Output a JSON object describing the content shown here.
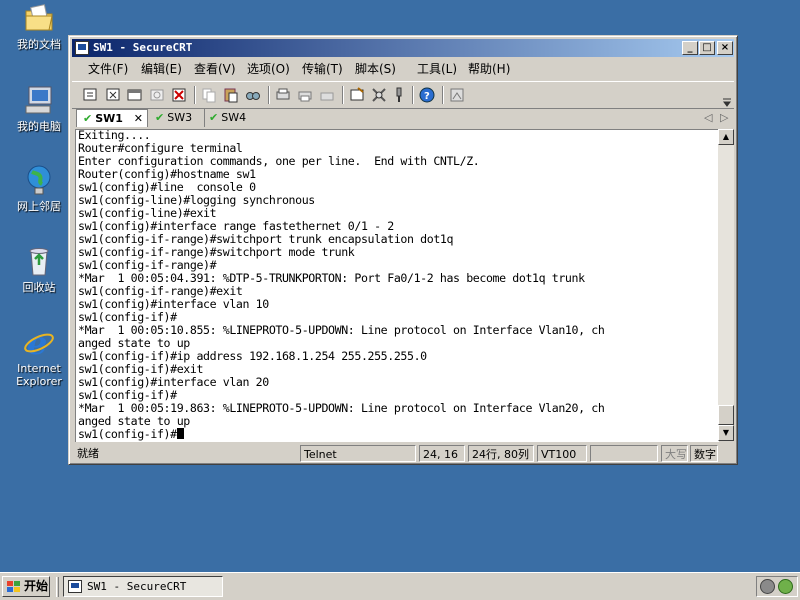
{
  "desktop": {
    "icons": [
      {
        "label": "我的文档"
      },
      {
        "label": "我的电脑"
      },
      {
        "label": "网上邻居"
      },
      {
        "label": "回收站"
      },
      {
        "label": "Internet Explorer"
      }
    ]
  },
  "window": {
    "title": "SW1 - SecureCRT",
    "menu": [
      "文件(F)",
      "编辑(E)",
      "查看(V)",
      "选项(O)",
      "传输(T)",
      "脚本(S)",
      "工具(L)",
      "帮助(H)"
    ],
    "tabs": [
      {
        "label": "SW1",
        "active": true
      },
      {
        "label": "SW3",
        "active": false
      },
      {
        "label": "SW4",
        "active": false
      }
    ],
    "terminal_lines": [
      "Exiting....",
      "Router#configure terminal",
      "Enter configuration commands, one per line.  End with CNTL/Z.",
      "Router(config)#hostname sw1",
      "sw1(config)#line  console 0",
      "sw1(config-line)#logging synchronous",
      "sw1(config-line)#exit",
      "sw1(config)#interface range fastethernet 0/1 - 2",
      "sw1(config-if-range)#switchport trunk encapsulation dot1q",
      "sw1(config-if-range)#switchport mode trunk",
      "sw1(config-if-range)#",
      "*Mar  1 00:05:04.391: %DTP-5-TRUNKPORTON: Port Fa0/1-2 has become dot1q trunk",
      "sw1(config-if-range)#exit",
      "sw1(config)#interface vlan 10",
      "sw1(config-if)#",
      "*Mar  1 00:05:10.855: %LINEPROTO-5-UPDOWN: Line protocol on Interface Vlan10, ch",
      "anged state to up",
      "sw1(config-if)#ip address 192.168.1.254 255.255.255.0",
      "sw1(config-if)#exit",
      "sw1(config)#interface vlan 20",
      "sw1(config-if)#",
      "*Mar  1 00:05:19.863: %LINEPROTO-5-UPDOWN: Line protocol on Interface Vlan20, ch",
      "anged state to up",
      "sw1(config-if)#"
    ],
    "status": {
      "ready": "就绪",
      "protocol": "Telnet",
      "cursor_pos": "24, 16",
      "size": "24行, 80列",
      "emulation": "VT100",
      "caps": "大写",
      "num": "数字"
    }
  },
  "taskbar": {
    "start_label": "开始",
    "task_label": "SW1 - SecureCRT"
  },
  "colors": {
    "desktop": "#3a6ea5",
    "titlebar_start": "#0a246a",
    "titlebar_end": "#a6caf0"
  }
}
